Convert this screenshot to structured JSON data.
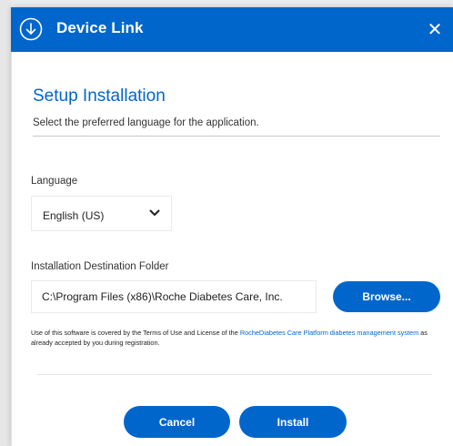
{
  "window": {
    "title": "Device Link",
    "close_symbol": "✕",
    "title_icon": "download-circle-icon",
    "accent_color": "#0066cc"
  },
  "setup": {
    "heading": "Setup Installation",
    "subtitle": "Select the preferred language for the application."
  },
  "language": {
    "label": "Language",
    "selected": "English (US)"
  },
  "destination": {
    "label": "Installation Destination Folder",
    "value": "C:\\Program Files (x86)\\Roche Diabetes Care, Inc.",
    "browse_label": "Browse..."
  },
  "legal": {
    "prefix": "Use of this software is covered by the Terms of Use and License of the ",
    "link_text": "RocheDiabetes Care Platform diabetes management system",
    "suffix": " as already accepted by you during registration."
  },
  "actions": {
    "cancel_label": "Cancel",
    "install_label": "Install"
  }
}
